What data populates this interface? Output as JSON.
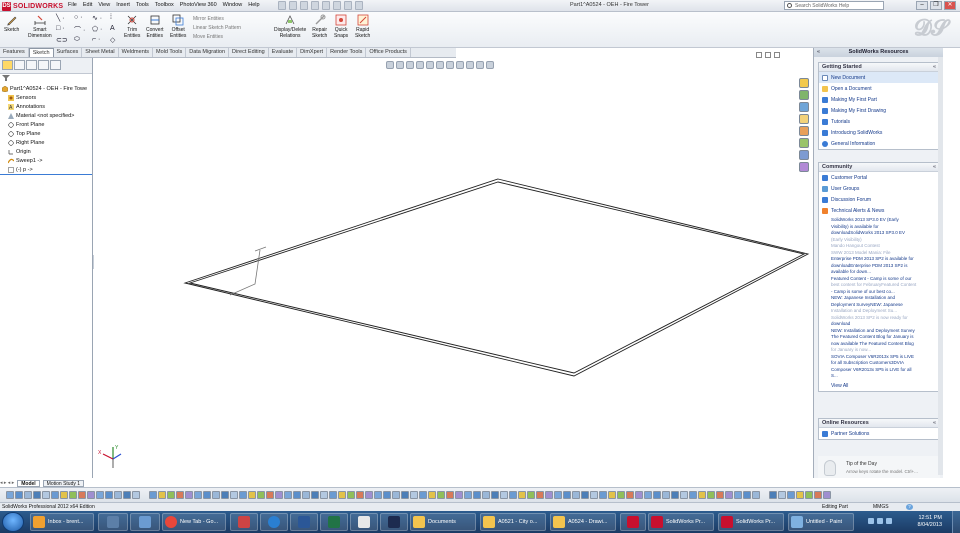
{
  "app": {
    "brand": "SOLIDWORKS",
    "window_title": "Part1^A0524 - OEH - Fire Tower",
    "menus": [
      "File",
      "Edit",
      "View",
      "Insert",
      "Tools",
      "Toolbox",
      "PhotoView 360",
      "Window",
      "Help"
    ],
    "search_placeholder": "Search SolidWorks Help",
    "window_buttons": [
      "–",
      "❐",
      "✕"
    ]
  },
  "command_manager": {
    "buttons": [
      {
        "label": "Sketch"
      },
      {
        "label": "Smart\nDimension"
      },
      {
        "label": "Trim\nEntities"
      },
      {
        "label": "Convert\nEntities"
      },
      {
        "label": "Offset\nEntities"
      },
      {
        "label": "Display/Delete\nRelations"
      },
      {
        "label": "Repair\nSketch"
      },
      {
        "label": "Quick\nSnaps"
      },
      {
        "label": "Rapid\nSketch"
      }
    ],
    "options": [
      "Mirror Entities",
      "Linear Sketch Pattern",
      "Move Entities"
    ]
  },
  "tabs": [
    "Features",
    "Sketch",
    "Surfaces",
    "Sheet Metal",
    "Weldments",
    "Mold Tools",
    "Data Migration",
    "Direct Editing",
    "Evaluate",
    "DimXpert",
    "Render Tools",
    "Office Products"
  ],
  "active_tab": "Sketch",
  "feature_tree": {
    "items": [
      {
        "label": "Part1^A0524 - OEH - Fire Towe",
        "icon": "part-icon"
      },
      {
        "label": "Sensors",
        "icon": "sensor-icon"
      },
      {
        "label": "Annotations",
        "icon": "annotation-icon"
      },
      {
        "label": "Material <not specified>",
        "icon": "material-icon"
      },
      {
        "label": "Front Plane",
        "icon": "plane-icon"
      },
      {
        "label": "Top Plane",
        "icon": "plane-icon"
      },
      {
        "label": "Right Plane",
        "icon": "plane-icon"
      },
      {
        "label": "Origin",
        "icon": "origin-icon"
      },
      {
        "label": "Sweep1 ->",
        "icon": "sweep-icon"
      },
      {
        "label": "(-) p ->",
        "icon": "sketch-icon"
      }
    ]
  },
  "graphics": {
    "triad": {
      "x_label": "X",
      "y_label": "Y"
    }
  },
  "resources": {
    "title": "SolidWorks Resources",
    "getting_started": {
      "title": "Getting Started",
      "items": [
        "New Document",
        "Open a Document",
        "Making My First Part",
        "Making My First Drawing",
        "Tutorials",
        "Introducing SolidWorks",
        "General Information"
      ]
    },
    "community": {
      "title": "Community",
      "items": [
        "Customer Portal",
        "User Groups",
        "Discussion Forum",
        "Technical Alerts & News"
      ],
      "news": [
        "SolidWorks 2013 SP3.0 EV (Early",
        "Visibility) is available for",
        "downloadSolidWorks 2013 SP3.0 EV",
        "(Early Visibility)",
        "Mando Hangout Contest",
        "SWW 2013 Model Mania: File",
        "Enterprise PDM 2013 SP2 is available for",
        "downloadEnterprise PDM 2013 SP2 is",
        "available for down...",
        "Featured Content - Camp is some of our",
        "best content for FebruaryFeatured Content",
        "- Camp is some of our best co...",
        "NEW: Japanese Installation and",
        "Deployment SurveyNEW: Japanese",
        "Installation and Deployment Su...",
        "SolidWorks 2013 SP2 is now ready for",
        "download",
        "NEW: Installation and Deployment Survey",
        "The Featured Content Blog for January is",
        "now available The Featured Content Blog",
        "for January is now...",
        "SOVIA Composer V6R2013x SP5 is LIVE",
        "for all Subscription Customers3DVIA",
        "Composer V6R2013x SP5 is LIVE for all",
        "S..."
      ],
      "view_all": "View All"
    },
    "online": {
      "title": "Online Resources",
      "items": [
        "Partner Solutions"
      ]
    },
    "tip": {
      "title": "Tip of the Day",
      "sub": "Arrow keys rotate the model. Ctrl+..."
    }
  },
  "model_tabs": [
    "Model",
    "Motion Study 1"
  ],
  "status": {
    "left": "SolidWorks Professional 2012 x64 Edition",
    "mode": "Editing Part",
    "units": "MMGS",
    "help": "?"
  },
  "taskbar": {
    "buttons": [
      {
        "label": "Inbox - brent...",
        "color": "#f0a030"
      },
      {
        "label": "",
        "color": "#5c7fa8"
      },
      {
        "label": "",
        "color": "#6b9bd1"
      },
      {
        "label": "New Tab - Go...",
        "color": "#e8473b"
      },
      {
        "label": "",
        "color": "#c44"
      },
      {
        "label": "",
        "color": "#2a7fd1"
      },
      {
        "label": "",
        "color": "#2b5797"
      },
      {
        "label": "",
        "color": "#217346"
      },
      {
        "label": "",
        "color": "#e8e8e8"
      },
      {
        "label": "",
        "color": "#1d2b4f"
      },
      {
        "label": "Documents",
        "color": "#f3c44e"
      },
      {
        "label": "A0521 - City o...",
        "color": "#f3c44e"
      },
      {
        "label": "A0524 - Drawi...",
        "color": "#f3c44e"
      },
      {
        "label": "",
        "color": "#c8102e"
      },
      {
        "label": "SolidWorks Pr...",
        "color": "#c8102e"
      },
      {
        "label": "SolidWorks Pr...",
        "color": "#c8102e"
      },
      {
        "label": "Untitled - Paint",
        "color": "#7fb1e0"
      }
    ],
    "time": "12:51 PM",
    "date": "8/04/2013"
  }
}
